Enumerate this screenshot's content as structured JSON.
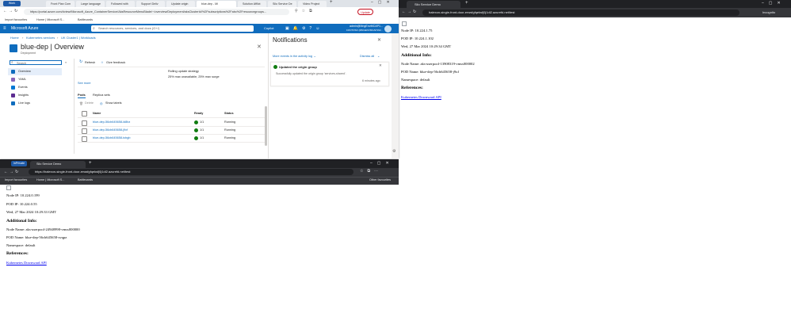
{
  "right_window": {
    "tab_label": "Silo Service Demo",
    "url": "halexon-single-front-door-erwsfgfqeksfj0j1di2.azurefd.net/test",
    "incognito_label": "Incognito",
    "node_ip": "Node IP: 10.224.1.75",
    "pod_ip": "POD IP: 10.224.1.102",
    "date": "Wed, 27 Mar 2024 10:29:34 GMT",
    "additional_heading": "Additional Info:",
    "node_name": "Node Name: aks-userpool-13908319-vmss000002",
    "pod_name": "POD Name: blue-dep-56cb645658-j9xf",
    "namespace": "Namespace: default",
    "references_heading": "References:",
    "link": "Kubernetes Downward API"
  },
  "bottom_window": {
    "profile_label": "InPrivate",
    "tab_label": "Silo Service Demo",
    "url": "https://halexon-single-front-door-erwsfgfqeksfj0j1di2.azurefd.net/test",
    "favorites": [
      "Import favourites",
      "Home | Microsoft S...",
      "Battlecards"
    ],
    "other_favs": "Other favourites",
    "node_ip": "Node IP: 10.224.0.199",
    "pod_ip": "POD IP: 10.224.0.55",
    "date": "Wed, 27 Mar 2024 10:29:33 GMT",
    "additional_heading": "Additional Info:",
    "node_name": "Node Name: aks-userpool-24948998-vmss000000",
    "pod_name": "POD Name: blue-dep-56cb645658-svqpz",
    "namespace": "Namespace: default",
    "references_heading": "References:",
    "link": "Kubernetes Downward API"
  },
  "azure": {
    "profile_label": "Work",
    "tabs": [
      "Front Plan Com",
      "Large language",
      "Followed with",
      "Support Deliv",
      "Update origin",
      "blue-dep - Mi",
      "Solution Afflict",
      "Silo Service De",
      "Video Project"
    ],
    "url": "https://portal.azure.com/#view/Microsoft_Azure_ContainerService/AksResourceMenuBlade/~/overview/Deployment/aksClusterId/%2Fsubscriptions%2Fabc%2Fresourcegroups...",
    "update_label": "Update",
    "favorites": [
      "Import favourites",
      "Home | Microsoft S...",
      "Battlecards"
    ],
    "brand": "Microsoft Azure",
    "search_placeholder": "Search resources, services, and docs (G+/)",
    "copilot": "Copilot",
    "account_email": "admin@MngEnvMCAP1...",
    "account_org": "CONTOSO (MNGENVMCAP192...",
    "breadcrumb": [
      "Home",
      "Kubernetes services",
      "UK Cluster1 | Workloads"
    ],
    "title": "blue-dep | Overview",
    "subtitle": "Deployment",
    "sidebar_search_placeholder": "Search",
    "sidebar": [
      "Overview",
      "YAML",
      "Events",
      "Insights",
      "Live logs"
    ],
    "commands": {
      "refresh": "Refresh",
      "feedback": "Give feedback"
    },
    "strategy_label": "Rolling update strategy",
    "strategy_value": "25% max unavailable, 25% max surge",
    "see_more": "See more",
    "pane_tabs": [
      "Pods",
      "Replica sets"
    ],
    "pod_commands": {
      "delete": "Delete",
      "labels": "Show labels"
    },
    "table_headers": {
      "name": "Name",
      "ready": "Ready",
      "status": "Status"
    },
    "pods": [
      {
        "name": "blue-dep-56cb645658-ld8bz",
        "ready": "1/1",
        "status": "Running"
      },
      {
        "name": "blue-dep-56cb645658-j9xf",
        "ready": "1/1",
        "status": "Running"
      },
      {
        "name": "blue-dep-56cb645658-tcbgb",
        "ready": "1/1",
        "status": "Running"
      }
    ],
    "notifications": {
      "title": "Notifications",
      "more": "More events in the activity log →",
      "dismiss": "Dismiss all",
      "card_title": "Updated the origin group",
      "card_body": "Successfully updated the origin group 'services-shared'.",
      "card_time": "6 minutes ago"
    }
  },
  "colors": {
    "azure_blue": "#0f6cbd",
    "success": "#107c10",
    "chrome_dark": "#202124"
  }
}
